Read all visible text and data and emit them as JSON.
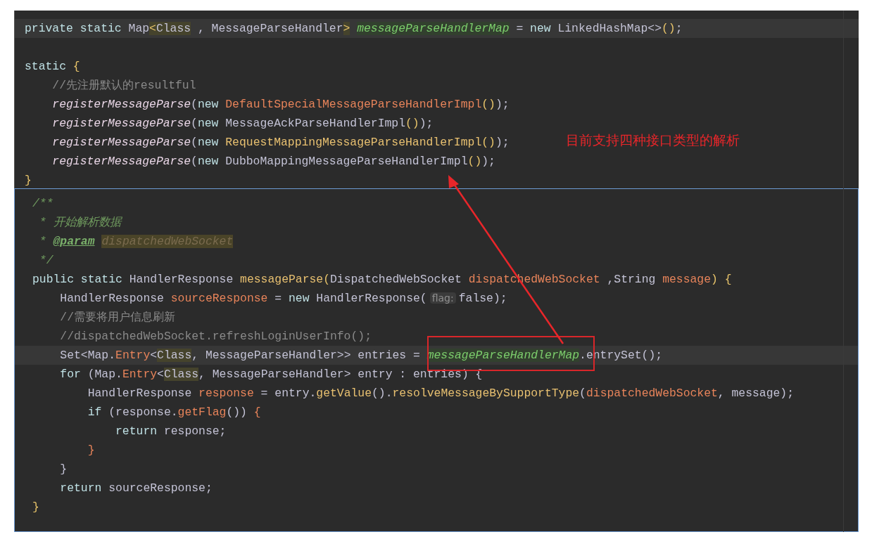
{
  "panels": [
    {
      "focused": false,
      "lines": [
        {
          "current": true,
          "tokens": [
            {
              "text": "private static ",
              "kind": "kw"
            },
            {
              "text": "Map",
              "kind": "plain"
            },
            {
              "text": "<",
              "kind": "brace",
              "hl": true
            },
            {
              "text": "Class",
              "kind": "plain",
              "hl": true
            },
            {
              "text": " , MessageParseHandler",
              "kind": "plain"
            },
            {
              "text": ">",
              "kind": "brace",
              "hl": true
            },
            {
              "text": "messageParseHandlerMap",
              "kind": "field",
              "hl": true
            },
            {
              "text": " = ",
              "kind": "plain"
            },
            {
              "text": "new",
              "kind": "kw"
            },
            {
              "text": " LinkedHashMap<>",
              "kind": "plain"
            },
            {
              "text": "()",
              "kind": "brace"
            },
            {
              "text": ";",
              "kind": "plain"
            }
          ]
        },
        {
          "current": false
        },
        {
          "current": false,
          "tokens": [
            {
              "text": "static ",
              "kind": "kw"
            },
            {
              "text": "{",
              "kind": "brace"
            }
          ],
          "children": [
            {
              "current": false,
              "tokens": [
                {
                  "text": "//先注册默认的resultful",
                  "kind": "comment"
                }
              ]
            },
            {
              "current": false,
              "tokens": [
                {
                  "text": "registerMessageParse",
                  "kind": "call"
                },
                {
                  "text": "(",
                  "kind": "plain"
                },
                {
                  "text": "new ",
                  "kind": "kw"
                },
                {
                  "text": "DefaultSpecialMessageParseHandlerImpl",
                  "kind": "orange"
                },
                {
                  "text": "()",
                  "kind": "brace"
                },
                {
                  "text": ");",
                  "kind": "plain"
                }
              ]
            },
            {
              "current": false,
              "tokens": [
                {
                  "text": "registerMessageParse",
                  "kind": "call"
                },
                {
                  "text": "(",
                  "kind": "plain"
                },
                {
                  "text": "new",
                  "kind": "kw"
                },
                {
                  "text": " MessageAckParseHandlerImpl",
                  "kind": "plain"
                },
                {
                  "text": "()",
                  "kind": "brace"
                },
                {
                  "text": ");",
                  "kind": "plain"
                }
              ]
            },
            {
              "current": false,
              "tokens": [
                {
                  "text": "registerMessageParse",
                  "kind": "call"
                },
                {
                  "text": "(",
                  "kind": "plain"
                },
                {
                  "text": "new ",
                  "kind": "kw"
                },
                {
                  "text": "RequestMappingMessageParseHandlerImpl",
                  "kind": "gold"
                },
                {
                  "text": "()",
                  "kind": "brace"
                },
                {
                  "text": ");",
                  "kind": "plain"
                }
              ]
            },
            {
              "current": false,
              "tokens": [
                {
                  "text": "registerMessageParse",
                  "kind": "call"
                },
                {
                  "text": "(",
                  "kind": "plain"
                },
                {
                  "text": "new",
                  "kind": "kw"
                },
                {
                  "text": " DubboMappingMessageParseHandlerImpl",
                  "kind": "plain"
                },
                {
                  "text": "()",
                  "kind": "brace"
                },
                {
                  "text": ");",
                  "kind": "plain"
                }
              ]
            }
          ]
        },
        {
          "current": false,
          "tokens": [
            {
              "text": "}",
              "kind": "brace"
            }
          ]
        }
      ]
    },
    {
      "focused": true,
      "lines": [
        {
          "current": false,
          "tokens": [
            {
              "text": "/**",
              "kind": "doc"
            }
          ]
        },
        {
          "current": false,
          "tokens": [
            {
              "text": " * 开始解析数据",
              "kind": "doc"
            }
          ]
        },
        {
          "current": false,
          "tokens": [
            {
              "text": " * ",
              "kind": "doc"
            },
            {
              "text": "@param",
              "kind": "doctag"
            },
            {
              "text": "dispatchedWebSocket",
              "kind": "docparam"
            }
          ]
        },
        {
          "current": false,
          "tokens": [
            {
              "text": " */",
              "kind": "doc"
            }
          ]
        },
        {
          "current": false,
          "tokens": [
            {
              "text": "public static ",
              "kind": "kw"
            },
            {
              "text": "HandlerResponse ",
              "kind": "plain"
            },
            {
              "text": "messageParse",
              "kind": "gold"
            },
            {
              "text": "(",
              "kind": "brace"
            },
            {
              "text": "DispatchedWebSocket ",
              "kind": "plain"
            },
            {
              "text": "dispatchedWebSocket",
              "kind": "orange"
            },
            {
              "text": " ,String ",
              "kind": "plain"
            },
            {
              "text": "message",
              "kind": "orange"
            },
            {
              "text": ") {",
              "kind": "brace"
            }
          ],
          "children": [
            {
              "current": false,
              "tokens": [
                {
                  "text": "HandlerResponse ",
                  "kind": "plain"
                },
                {
                  "text": "sourceResponse",
                  "kind": "orange"
                },
                {
                  "text": " = ",
                  "kind": "plain"
                },
                {
                  "text": "new",
                  "kind": "kw"
                },
                {
                  "text": " HandlerResponse(",
                  "kind": "plain"
                },
                {
                  "text": "flag:",
                  "kind": "hint"
                },
                {
                  "text": "false);",
                  "kind": "plain"
                }
              ]
            },
            {
              "current": false,
              "tokens": [
                {
                  "text": "//需要将用户信息刷新",
                  "kind": "comment"
                }
              ]
            },
            {
              "current": false,
              "tokens": [
                {
                  "text": "//dispatchedWebSocket.refreshLoginUserInfo();",
                  "kind": "comment"
                }
              ]
            },
            {
              "current": true,
              "tokens": [
                {
                  "text": "Set<Map.",
                  "kind": "plain"
                },
                {
                  "text": "Entry",
                  "kind": "orange"
                },
                {
                  "text": "<",
                  "kind": "plain"
                },
                {
                  "text": "Class",
                  "kind": "plain",
                  "hl": true
                },
                {
                  "text": ", MessageParseHandler>> entries =",
                  "kind": "plain"
                },
                {
                  "text": "messageParseHandlerMap",
                  "kind": "field",
                  "hl": true
                },
                {
                  "text": ".entrySet();",
                  "kind": "plain"
                }
              ]
            },
            {
              "current": false,
              "tokens": [
                {
                  "text": "for",
                  "kind": "kw"
                },
                {
                  "text": " (Map.",
                  "kind": "plain"
                },
                {
                  "text": "Entry",
                  "kind": "orange"
                },
                {
                  "text": "<",
                  "kind": "plain"
                },
                {
                  "text": "Class",
                  "kind": "plain",
                  "hl": true
                },
                {
                  "text": ", MessageParseHandler> entry : entries) {",
                  "kind": "plain"
                }
              ],
              "children": [
                {
                  "current": false,
                  "tokens": [
                    {
                      "text": "HandlerResponse ",
                      "kind": "plain"
                    },
                    {
                      "text": "response",
                      "kind": "orange"
                    },
                    {
                      "text": " = entry.",
                      "kind": "plain"
                    },
                    {
                      "text": "getValue",
                      "kind": "gold"
                    },
                    {
                      "text": "().",
                      "kind": "plain"
                    },
                    {
                      "text": "resolveMessageBySupportType",
                      "kind": "gold"
                    },
                    {
                      "text": "(",
                      "kind": "plain"
                    },
                    {
                      "text": "dispatchedWebSocket",
                      "kind": "orange"
                    },
                    {
                      "text": ", message);",
                      "kind": "plain"
                    }
                  ]
                },
                {
                  "current": false,
                  "tokens": [
                    {
                      "text": "if",
                      "kind": "kw"
                    },
                    {
                      "text": " (response.",
                      "kind": "plain"
                    },
                    {
                      "text": "getFlag",
                      "kind": "orange"
                    },
                    {
                      "text": "()) ",
                      "kind": "plain"
                    },
                    {
                      "text": "{",
                      "kind": "orange"
                    }
                  ],
                  "children": [
                    {
                      "current": false,
                      "tokens": [
                        {
                          "text": "return",
                          "kind": "kw"
                        },
                        {
                          "text": " response;",
                          "kind": "plain"
                        }
                      ]
                    }
                  ]
                },
                {
                  "current": false,
                  "tokens": [
                    {
                      "text": "}",
                      "kind": "orange"
                    }
                  ]
                }
              ]
            },
            {
              "current": false,
              "tokens": [
                {
                  "text": "}",
                  "kind": "plain"
                }
              ]
            },
            {
              "current": false,
              "tokens": [
                {
                  "text": "return",
                  "kind": "kw"
                },
                {
                  "text": " sourceResponse;",
                  "kind": "plain"
                }
              ]
            }
          ]
        },
        {
          "current": false,
          "tokens": [
            {
              "text": "}",
              "kind": "brace"
            }
          ]
        }
      ]
    }
  ],
  "annotation": {
    "text": "目前支持四种接口类型的解析"
  }
}
